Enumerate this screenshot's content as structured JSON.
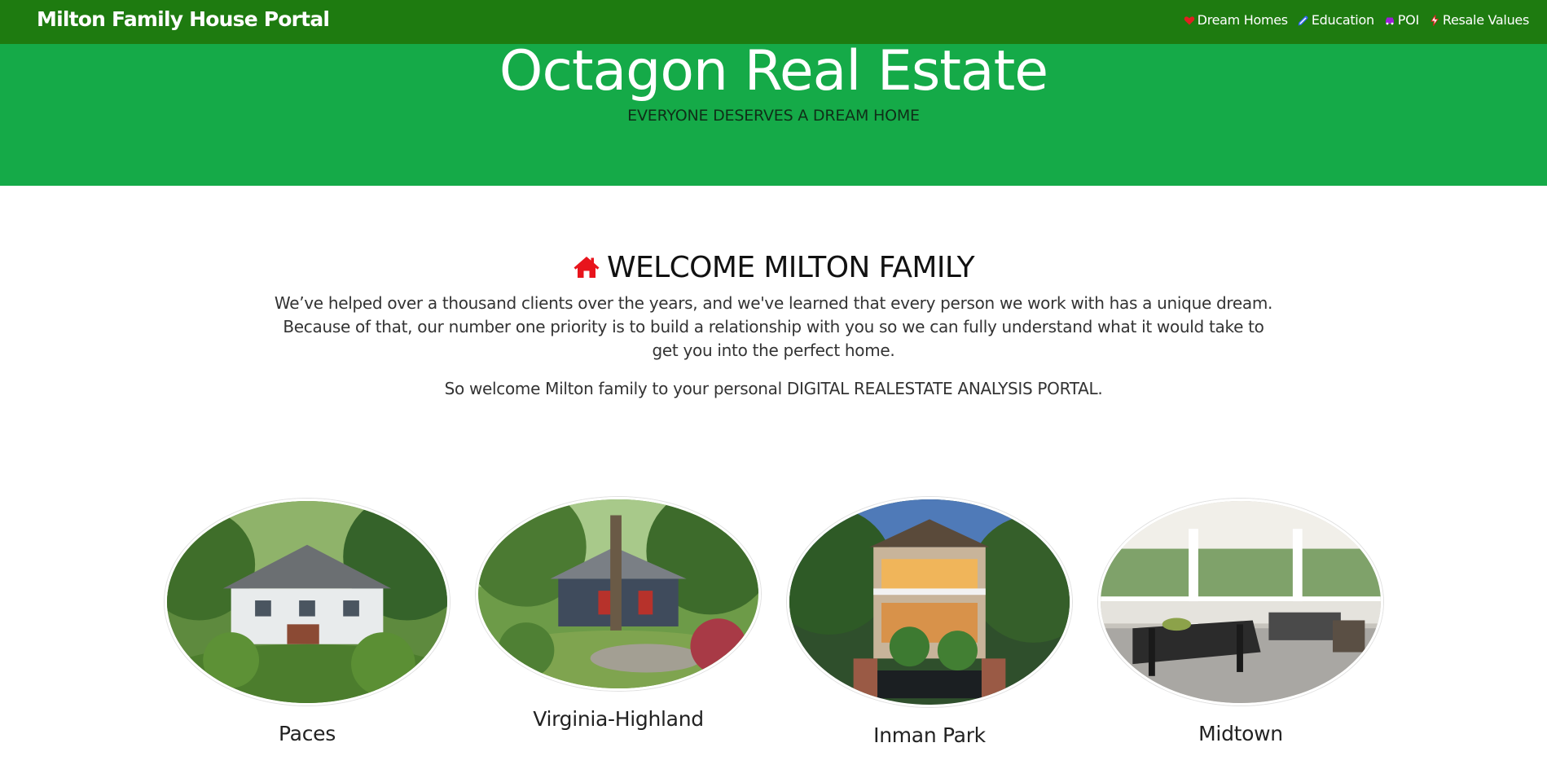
{
  "nav": {
    "brand": "Milton Family House Portal",
    "links": [
      {
        "label": "Dream Homes",
        "icon": "heart-icon",
        "color": "#e02020"
      },
      {
        "label": "Education",
        "icon": "pencil-icon",
        "color": "#3366ff"
      },
      {
        "label": "POI",
        "icon": "car-icon",
        "color": "#9b1fd6"
      },
      {
        "label": "Resale Values",
        "icon": "bolt-icon",
        "color": "#e02020"
      }
    ]
  },
  "hero": {
    "title": "Octagon Real Estate",
    "subtitle": "EVERYONE DESERVES A DREAM HOME"
  },
  "welcome": {
    "icon": "home-icon",
    "icon_color": "#e8141c",
    "heading": "WELCOME MILTON FAMILY",
    "paragraph": "We’ve helped over a thousand clients over the years, and we've learned that every person we work with has a unique dream. Because of that, our number one priority is to build a relationship with you so we can fully understand what it would take to get you into the perfect home.",
    "portal_text": "So welcome Milton family to your personal DIGITAL REALESTATE ANALYSIS PORTAL."
  },
  "neighborhoods": [
    {
      "name": "Paces"
    },
    {
      "name": "Virginia-Highland"
    },
    {
      "name": "Inman Park"
    },
    {
      "name": "Midtown"
    }
  ],
  "colors": {
    "navbar": "#1e7b10",
    "hero": "#15aa48"
  }
}
